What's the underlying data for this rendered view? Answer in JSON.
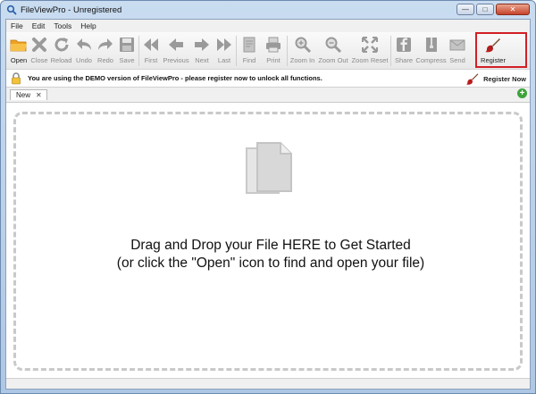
{
  "window": {
    "title": "FileViewPro - Unregistered",
    "controls": {
      "minimize": "—",
      "maximize": "□",
      "close": "✕"
    }
  },
  "menu": [
    "File",
    "Edit",
    "Tools",
    "Help"
  ],
  "toolbar": {
    "buttons": [
      {
        "label": "Open",
        "icon": "folder-open-icon",
        "enabled": true
      },
      {
        "label": "Close",
        "icon": "close-x-icon",
        "enabled": false
      },
      {
        "label": "Reload",
        "icon": "reload-icon",
        "enabled": false
      },
      {
        "label": "Undo",
        "icon": "undo-icon",
        "enabled": false
      },
      {
        "label": "Redo",
        "icon": "redo-icon",
        "enabled": false
      },
      {
        "label": "Save",
        "icon": "save-icon",
        "enabled": false
      },
      {
        "label": "First",
        "icon": "first-icon",
        "enabled": false
      },
      {
        "label": "Previous",
        "icon": "previous-icon",
        "enabled": false
      },
      {
        "label": "Next",
        "icon": "next-icon",
        "enabled": false
      },
      {
        "label": "Last",
        "icon": "last-icon",
        "enabled": false
      },
      {
        "label": "Find",
        "icon": "find-icon",
        "enabled": false
      },
      {
        "label": "Print",
        "icon": "print-icon",
        "enabled": false
      },
      {
        "label": "Zoom In",
        "icon": "zoom-in-icon",
        "enabled": false
      },
      {
        "label": "Zoom Out",
        "icon": "zoom-out-icon",
        "enabled": false
      },
      {
        "label": "Zoom Reset",
        "icon": "zoom-reset-icon",
        "enabled": false
      },
      {
        "label": "Share",
        "icon": "share-icon",
        "enabled": false
      },
      {
        "label": "Compress",
        "icon": "compress-icon",
        "enabled": false
      },
      {
        "label": "Send",
        "icon": "send-icon",
        "enabled": false
      },
      {
        "label": "Register",
        "icon": "register-brush-icon",
        "enabled": true
      }
    ]
  },
  "demo_bar": {
    "message": "You are using the DEMO version of FileViewPro - please register now to unlock all functions.",
    "register_now": "Register Now"
  },
  "tabs": [
    {
      "label": "New",
      "close": "✕"
    }
  ],
  "add_tab": "+",
  "dropzone": {
    "line1": "Drag and Drop your File HERE to Get Started",
    "line2": "(or click the \"Open\" icon to find and open your file)"
  },
  "colors": {
    "highlight": "#d21f25",
    "add_tab": "#3ea33a",
    "folder": "#f0a223"
  }
}
